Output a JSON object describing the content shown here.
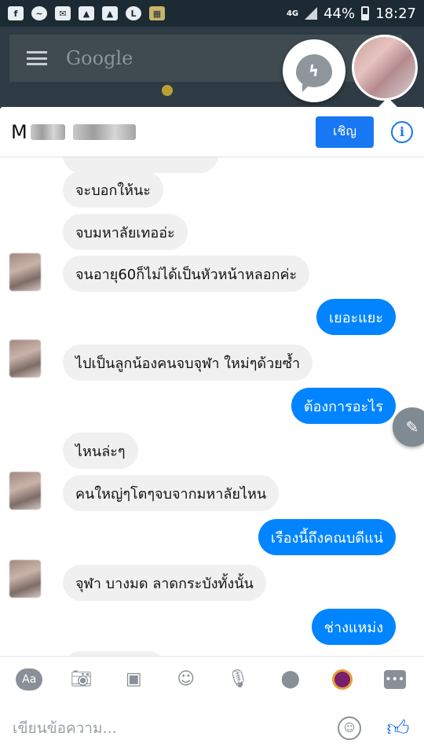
{
  "status_bar": {
    "network": "4G",
    "battery": "44%",
    "time": "18:27",
    "icons": [
      "facebook-icon",
      "messenger-icon",
      "mail-icon",
      "gallery-icon",
      "gallery-icon",
      "line-icon",
      "app-icon"
    ]
  },
  "background_app": {
    "search_text": "Google"
  },
  "header": {
    "title_initial": "M",
    "invite_label": "เชิญ",
    "info_label": "i"
  },
  "messages": [
    {
      "text": "จะบอกให้นะ",
      "dir": "in"
    },
    {
      "text": "จบมหาลัยเทออ่ะ",
      "dir": "in"
    },
    {
      "text": "จนอายุ60ก็ไม่ได้เป็นหัวหน้าหลอกค่ะ",
      "dir": "in"
    },
    {
      "text": "เยอะแยะ",
      "dir": "out"
    },
    {
      "text": "ไปเป็นลูกน้องคนจบจุฬา ใหม่ๆด้วยซ้ำ",
      "dir": "in"
    },
    {
      "text": "ต้องการอะไร",
      "dir": "out"
    },
    {
      "text": "ไหนล่ะๆ",
      "dir": "in"
    },
    {
      "text": "คนใหญ่ๆโตๆจบจากมหาลัยไหน",
      "dir": "in"
    },
    {
      "text": "เรืองนี้ถึงคณบดีแน่",
      "dir": "out"
    },
    {
      "text": "จุฬา บางมด ลาดกระบังทั้งนั้น",
      "dir": "in"
    },
    {
      "text": "ช่างแหม่ง",
      "dir": "out"
    }
  ],
  "toolbar": {
    "text_format_label": "Aa",
    "icons": [
      "camera-icon",
      "image-icon",
      "smiley-icon",
      "microphone-icon",
      "location-icon",
      "sticker-icon",
      "more-icon"
    ]
  },
  "composer": {
    "placeholder": "เขียนข้อความ..."
  },
  "colors": {
    "accent": "#1877f2",
    "outgoing_bubble": "#0084ff",
    "incoming_bubble": "#f0f0f0"
  }
}
